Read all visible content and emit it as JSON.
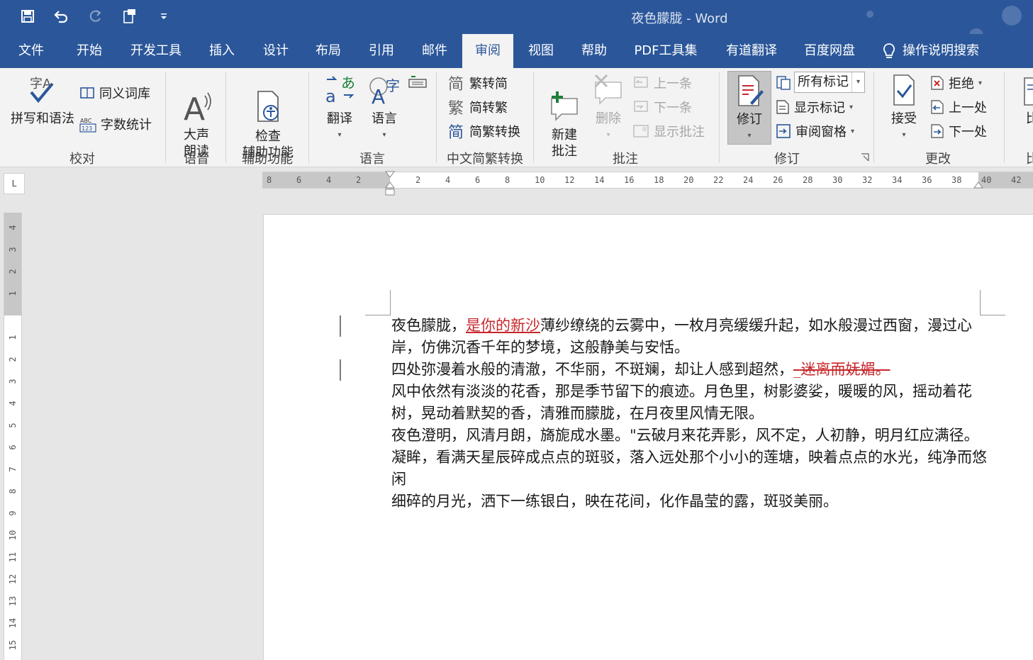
{
  "window": {
    "title": "夜色朦胧 - Word"
  },
  "tabs": [
    "文件",
    "开始",
    "开发工具",
    "插入",
    "设计",
    "布局",
    "引用",
    "邮件",
    "审阅",
    "视图",
    "帮助",
    "PDF工具集",
    "有道翻译",
    "百度网盘"
  ],
  "active_tab": "审阅",
  "tell_me": "操作说明搜索",
  "ribbon": {
    "proofing": {
      "label": "校对",
      "spelling": "拼写和语法",
      "thesaurus": "同义词库",
      "word_count": "字数统计"
    },
    "speech": {
      "label": "语音",
      "read_aloud": "大声\n朗读"
    },
    "accessibility": {
      "label": "辅助功能",
      "check": "检查\n辅助功能"
    },
    "language": {
      "label": "语言",
      "translate": "翻译",
      "language": "语言"
    },
    "chinese": {
      "label": "中文简繁转换",
      "trad_to_simp": "繁转简",
      "simp_to_trad": "简转繁",
      "convert": "简繁转换"
    },
    "comments": {
      "label": "批注",
      "new": "新建\n批注",
      "delete": "删除",
      "prev": "上一条",
      "next": "下一条",
      "show": "显示批注"
    },
    "tracking": {
      "label": "修订",
      "track": "修订",
      "markup_select": "所有标记",
      "show_markup": "显示标记",
      "review_pane": "审阅窗格"
    },
    "changes": {
      "label": "更改",
      "accept": "接受",
      "reject": "拒绝",
      "prev": "上一处",
      "next": "下一处"
    },
    "compare": {
      "label": "比",
      "btn": "比"
    }
  },
  "ruler": {
    "h_ticks": [
      "8",
      "6",
      "4",
      "2",
      "",
      "2",
      "4",
      "6",
      "8",
      "10",
      "12",
      "14",
      "16",
      "18",
      "20",
      "22",
      "24",
      "26",
      "28",
      "30",
      "32",
      "34",
      "36",
      "38",
      "40",
      "42"
    ],
    "v_ticks": [
      "4",
      "3",
      "2",
      "1",
      "",
      "1",
      "2",
      "3",
      "4",
      "5",
      "6",
      "7",
      "8",
      "9",
      "10",
      "11",
      "12",
      "13",
      "14",
      "15"
    ]
  },
  "document": {
    "p1_a": "夜色朦胧，",
    "p1_ins": "是你的新沙",
    "p1_b": "薄纱缭绕的云雾中，一枚月亮缓缓升起，如水般漫过西窗，漫过心岸，仿佛沉香千年的梦境，这般静美与安恬。",
    "p2_a": "四处弥漫着水般的清澈，不华丽，不斑斓，却让人感到超然，",
    "p2_del": "_迷离而妩媚。",
    "p3": "风中依然有淡淡的花香，那是季节留下的痕迹。月色里，树影婆娑，暖暖的风，摇动着花树，晃动着默契的香，清雅而朦胧，在月夜里风情无限。",
    "p4": "夜色澄明，风清月朗，旖旎成水墨。\"云破月来花弄影，风不定，人初静，明月红应满径。",
    "p5": "凝眸，看满天星辰碎成点点的斑驳，落入远处那个小小的莲塘，映着点点的水光，纯净而悠闲",
    "p6": "细碎的月光，洒下一练银白，映在花间，化作晶莹的露，斑驳美丽。"
  },
  "colors": {
    "brand": "#2b579a",
    "revision": "#c8272c"
  }
}
